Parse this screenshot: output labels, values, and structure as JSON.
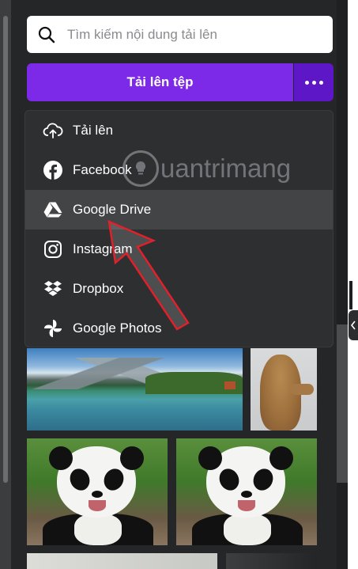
{
  "search": {
    "placeholder": "Tìm kiếm nội dung tải lên"
  },
  "upload": {
    "button_label": "Tải lên tệp"
  },
  "menu": {
    "items": [
      {
        "label": "Tải lên",
        "icon": "cloud-upload-icon",
        "active": false
      },
      {
        "label": "Facebook",
        "icon": "facebook-icon",
        "active": false
      },
      {
        "label": "Google Drive",
        "icon": "google-drive-icon",
        "active": true
      },
      {
        "label": "Instagram",
        "icon": "instagram-icon",
        "active": false
      },
      {
        "label": "Dropbox",
        "icon": "dropbox-icon",
        "active": false
      },
      {
        "label": "Google Photos",
        "icon": "google-photos-icon",
        "active": false
      }
    ]
  },
  "watermark": {
    "text": "uantrimang"
  },
  "colors": {
    "accent": "#7d2ae8",
    "accent_dark": "#5d17c7",
    "panel_bg": "#252627",
    "menu_bg": "#2e2f31",
    "menu_active": "#434446",
    "annotation_arrow": "#e0202a"
  },
  "gallery": {
    "images": [
      {
        "name": "lake-mountain-photo"
      },
      {
        "name": "cat-photo"
      },
      {
        "name": "panda-photo"
      },
      {
        "name": "panda-photo"
      },
      {
        "name": "light-photo"
      },
      {
        "name": "dark-photo"
      }
    ]
  }
}
